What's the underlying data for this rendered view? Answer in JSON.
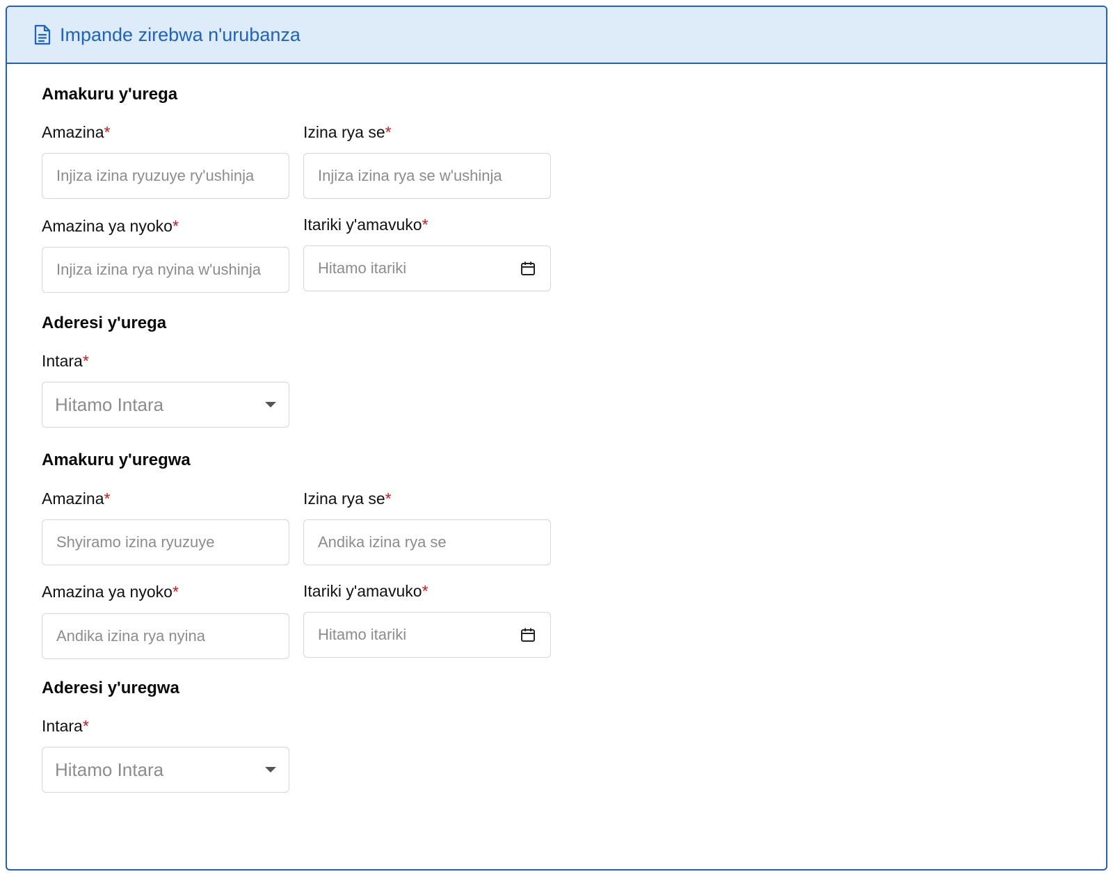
{
  "header": {
    "title": "Impande zirebwa n'urubanza",
    "icon": "document-icon"
  },
  "plaintiff": {
    "section_title": "Amakuru y'urega",
    "full_name": {
      "label": "Amazina",
      "required": "*",
      "placeholder": "Injiza izina ryuzuye ry'ushinja"
    },
    "father_name": {
      "label": "Izina rya se",
      "required": "*",
      "placeholder": "Injiza izina rya se w'ushinja"
    },
    "mother_name": {
      "label": "Amazina ya nyoko",
      "required": "*",
      "placeholder": "Injiza izina rya nyina w'ushinja"
    },
    "birth_date": {
      "label": "Itariki y'amavuko",
      "required": "*",
      "placeholder": "Hitamo itariki",
      "icon": "calendar-icon"
    },
    "address_title": "Aderesi y'urega",
    "province": {
      "label": "Intara",
      "required": "*",
      "placeholder": "Hitamo Intara",
      "icon": "caret-down-icon"
    }
  },
  "defendant": {
    "section_title": "Amakuru y'uregwa",
    "full_name": {
      "label": "Amazina",
      "required": "*",
      "placeholder": "Shyiramo izina ryuzuye"
    },
    "father_name": {
      "label": "Izina rya se",
      "required": "*",
      "placeholder": "Andika izina rya se"
    },
    "mother_name": {
      "label": "Amazina ya nyoko",
      "required": "*",
      "placeholder": "Andika izina rya nyina"
    },
    "birth_date": {
      "label": "Itariki y'amavuko",
      "required": "*",
      "placeholder": "Hitamo itariki",
      "icon": "calendar-icon"
    },
    "address_title": "Aderesi y'uregwa",
    "province": {
      "label": "Intara",
      "required": "*",
      "placeholder": "Hitamo Intara",
      "icon": "caret-down-icon"
    }
  },
  "colors": {
    "accent": "#1c62c9",
    "header_bg": "#deebf8",
    "required": "#e0101a",
    "placeholder": "#8c8c8c"
  }
}
